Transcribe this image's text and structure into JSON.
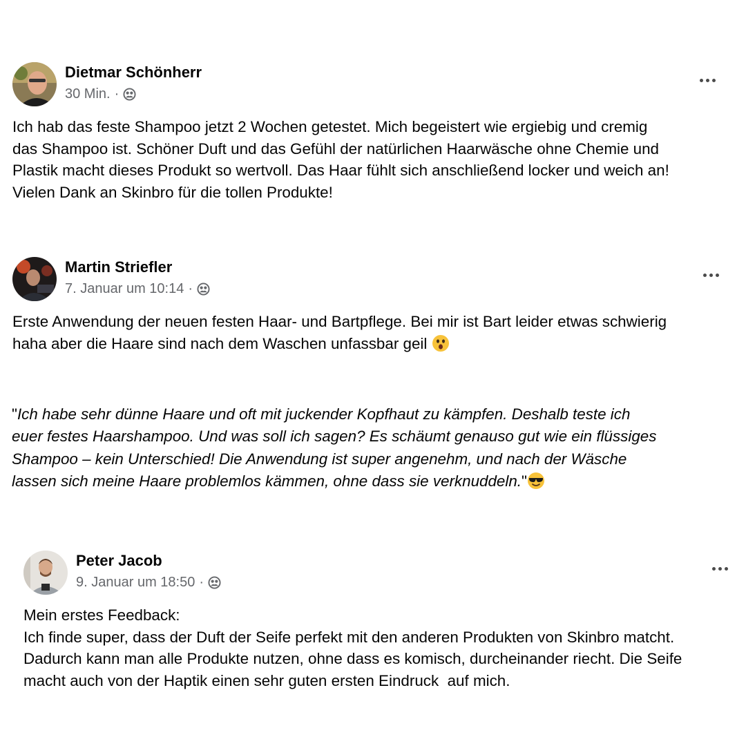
{
  "posts": [
    {
      "author": "Dietmar Schönherr",
      "time": "30 Min.",
      "separator": "·",
      "audience_icon": "friends-audience-icon",
      "menu_icon": "more-options-icon",
      "lines": [
        "Ich hab das feste Shampoo jetzt 2 Wochen getestet. Mich begeistert wie ergiebig und cremig",
        "das Shampoo ist. Schöner Duft und das Gefühl der natürlichen Haarwäsche ohne Chemie und",
        "Plastik macht dieses Produkt so wertvoll. Das Haar fühlt sich anschließend locker und weich an!",
        "Vielen Dank an Skinbro für die tollen Produkte!"
      ]
    },
    {
      "author": "Martin Striefler",
      "time": "7. Januar um 10:14",
      "separator": "·",
      "audience_icon": "friends-audience-icon",
      "menu_icon": "more-options-icon",
      "lines": [
        "Erste Anwendung der neuen festen Haar- und Bartpflege. Bei mir ist Bart leider etwas schwierig",
        "haha aber die Haare sind nach dem Waschen unfassbar geil"
      ],
      "trailing_emoji": "astonished-face-emoji"
    },
    {
      "author": "Peter Jacob",
      "time": "9. Januar um 18:50",
      "separator": "·",
      "audience_icon": "friends-audience-icon",
      "menu_icon": "more-options-icon",
      "lines": [
        "Mein erstes Feedback:",
        "Ich finde super, dass der Duft der Seife perfekt mit den anderen Produkten von Skinbro matcht.",
        "Dadurch kann man alle Produkte nutzen, ohne dass es komisch, durcheinander riecht. Die Seife",
        "macht auch von der Haptik einen sehr guten ersten Eindruck  auf mich."
      ]
    }
  ],
  "quote": {
    "open_mark": "\"",
    "lines": [
      "Ich habe sehr dünne Haare und oft mit juckender Kopfhaut zu kämpfen. Deshalb teste ich",
      "euer festes Haarshampoo. Und was soll ich sagen? Es schäumt genauso gut wie ein flüssiges",
      "Shampoo – kein Unterschied! Die Anwendung ist super angenehm, und nach der Wäsche",
      "lassen sich meine Haare problemlos kämmen, ohne dass sie verknuddeln."
    ],
    "close_mark": "\"",
    "trailing_emoji": "sunglasses-face-emoji"
  }
}
